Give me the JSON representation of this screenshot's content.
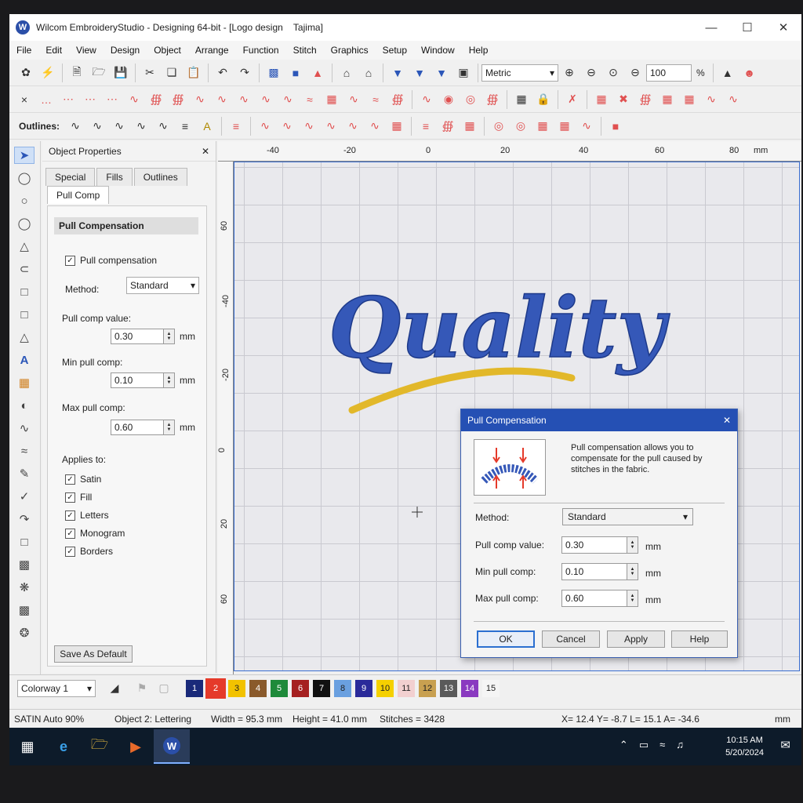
{
  "window": {
    "title": "Wilcom EmbroideryStudio - Designing 64-bit - [Logo design    Tajima]",
    "logo_letter": "W"
  },
  "menu": [
    "File",
    "Edit",
    "View",
    "Design",
    "Object",
    "Arrange",
    "Function",
    "Stitch",
    "Graphics",
    "Setup",
    "Window",
    "Help"
  ],
  "toolbar": {
    "units_combo": "Metric",
    "zoom_value": "100",
    "zoom_unit": "%",
    "outlines_label": "Outlines:"
  },
  "object_properties": {
    "title": "Object Properties",
    "tabs": [
      "Special",
      "Fills",
      "Outlines"
    ],
    "active_tab": "Pull Comp",
    "section_title": "Pull Compensation",
    "pull_comp_checkbox": "Pull compensation",
    "method_label": "Method:",
    "method_value": "Standard",
    "pull_comp_label": "Pull comp value:",
    "pull_comp_value": "0.30",
    "min_label": "Min pull comp:",
    "min_value": "0.10",
    "max_label": "Max pull comp:",
    "max_value": "0.60",
    "unit": "mm",
    "applies_label": "Applies to:",
    "applies": [
      "Satin",
      "Fill",
      "Letters",
      "Monogram",
      "Borders"
    ],
    "save_default": "Save As Default"
  },
  "ruler": {
    "top": [
      "-40",
      "-20",
      "0",
      "20",
      "40",
      "60",
      "80",
      "mm"
    ],
    "left": [
      "60",
      "-40",
      "-20",
      "0",
      "20",
      "60"
    ]
  },
  "design_text": "Quality",
  "colors": {
    "thread_blue": "#3558b8",
    "thread_gold": "#e2b82a",
    "accent": "#2550b4"
  },
  "dialog": {
    "title": "Pull Compensation",
    "description": "Pull compensation allows you to compensate for the pull caused by stitches in the fabric.",
    "method_label": "Method:",
    "method_value": "Standard",
    "pull_comp_label": "Pull comp value:",
    "pull_comp_value": "0.30",
    "min_label": "Min pull comp:",
    "min_value": "0.10",
    "max_label": "Max pull comp:",
    "max_value": "0.60",
    "unit": "mm",
    "ok": "OK",
    "cancel": "Cancel",
    "apply": "Apply",
    "help": "Help"
  },
  "palette": {
    "colorway": "Colorway 1",
    "swatches": [
      {
        "n": "1",
        "c": "#1a2a7a"
      },
      {
        "n": "2",
        "c": "#e53a2a"
      },
      {
        "n": "3",
        "c": "#f2c200"
      },
      {
        "n": "4",
        "c": "#8a5a2b"
      },
      {
        "n": "5",
        "c": "#1e8a3a"
      },
      {
        "n": "6",
        "c": "#a52020"
      },
      {
        "n": "7",
        "c": "#111111"
      },
      {
        "n": "8",
        "c": "#6aa0e0"
      },
      {
        "n": "9",
        "c": "#2a2a9a"
      },
      {
        "n": "10",
        "c": "#f5d000"
      },
      {
        "n": "11",
        "c": "#f2d0d0"
      },
      {
        "n": "12",
        "c": "#c8a050"
      },
      {
        "n": "13",
        "c": "#5a5a5a"
      },
      {
        "n": "14",
        "c": "#8a3ac0"
      },
      {
        "n": "15",
        "c": "#f5f5f5"
      }
    ]
  },
  "status": {
    "stitch_type": "SATIN   Auto 90%",
    "object": "Object 2: Lettering",
    "width": "Width = 95.3 mm",
    "height": "Height = 41.0 mm",
    "stitches": "Stitches = 3428",
    "coords": "X= 12.4  Y= -8.7   L= 15.1   A= -34.6",
    "unit": "mm"
  },
  "taskbar": {
    "time": "10:15 AM",
    "date": "5/20/2024"
  }
}
